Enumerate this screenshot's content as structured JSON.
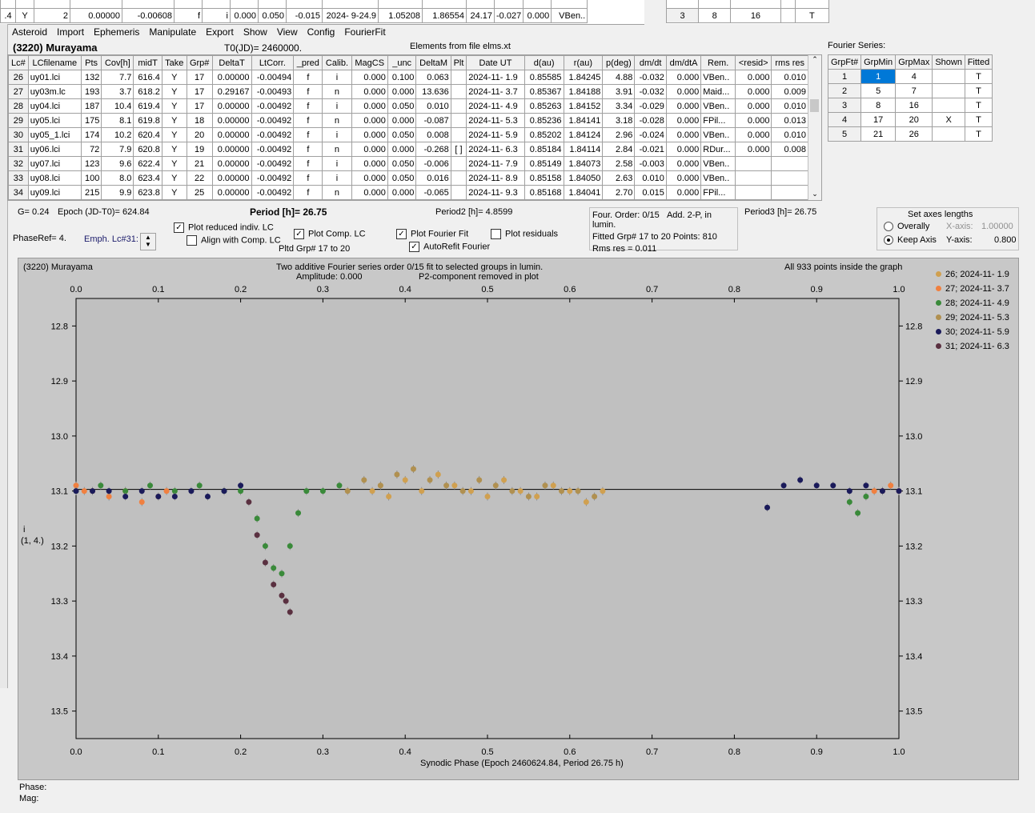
{
  "top_strip": {
    "rows": [
      {
        "a": ".4",
        "b": "Y",
        "c": "2",
        "d": "0.00000",
        "e": "-0.00608",
        "f": "f",
        "g": "i",
        "h": "0.000",
        "i": "0.050",
        "j": "-0.015",
        "k": "2024- 9-24.9",
        "l": "1.05208",
        "m": "1.86554",
        "n": "24.17",
        "o": "-0.027",
        "p": "0.000",
        "q": "VBen.."
      }
    ],
    "right_row": {
      "a": "3",
      "b": "8",
      "c": "16",
      "d": "",
      "e": "T"
    }
  },
  "menu": [
    "Asteroid",
    "Import",
    "Ephemeris",
    "Manipulate",
    "Export",
    "Show",
    "View",
    "Config",
    "FourierFit"
  ],
  "asteroid_title": "(3220) Murayama",
  "t0_label": "T0(JD)= 2460000.",
  "elements_label": "Elements from file elms.xt",
  "lc_table": {
    "headers": [
      "Lc#",
      "LCfilename",
      "Pts",
      "Cov[h]",
      "midT",
      "Take",
      "Grp#",
      "DeltaT",
      "LtCorr.",
      "_pred",
      "Calib.",
      "MagCS",
      "_unc",
      "DeltaM",
      "Plt",
      "Date UT",
      "d(au)",
      "r(au)",
      "p(deg)",
      "dm/dt",
      "dm/dtA",
      "Rem.",
      "<resid>",
      "rms res"
    ],
    "rows": [
      [
        "26",
        "uy01.lci",
        "132",
        "7.7",
        "616.4",
        "Y",
        "17",
        "0.00000",
        "-0.00494",
        "f",
        "i",
        "0.000",
        "0.100",
        "0.063",
        "",
        "2024-11- 1.9",
        "0.85585",
        "1.84245",
        "4.88",
        "-0.032",
        "0.000",
        "VBen..",
        "0.000",
        "0.010"
      ],
      [
        "27",
        "uy03m.lc",
        "193",
        "3.7",
        "618.2",
        "Y",
        "17",
        "0.29167",
        "-0.00493",
        "f",
        "n",
        "0.000",
        "0.000",
        "13.636",
        "",
        "2024-11- 3.7",
        "0.85367",
        "1.84188",
        "3.91",
        "-0.032",
        "0.000",
        "Maid...",
        "0.000",
        "0.009"
      ],
      [
        "28",
        "uy04.lci",
        "187",
        "10.4",
        "619.4",
        "Y",
        "17",
        "0.00000",
        "-0.00492",
        "f",
        "i",
        "0.000",
        "0.050",
        "0.010",
        "",
        "2024-11- 4.9",
        "0.85263",
        "1.84152",
        "3.34",
        "-0.029",
        "0.000",
        "VBen..",
        "0.000",
        "0.010"
      ],
      [
        "29",
        "uy05.lci",
        "175",
        "8.1",
        "619.8",
        "Y",
        "18",
        "0.00000",
        "-0.00492",
        "f",
        "n",
        "0.000",
        "0.000",
        "-0.087",
        "",
        "2024-11- 5.3",
        "0.85236",
        "1.84141",
        "3.18",
        "-0.028",
        "0.000",
        "FPil...",
        "0.000",
        "0.013"
      ],
      [
        "30",
        "uy05_1.lci",
        "174",
        "10.2",
        "620.4",
        "Y",
        "20",
        "0.00000",
        "-0.00492",
        "f",
        "i",
        "0.000",
        "0.050",
        "0.008",
        "",
        "2024-11- 5.9",
        "0.85202",
        "1.84124",
        "2.96",
        "-0.024",
        "0.000",
        "VBen..",
        "0.000",
        "0.010"
      ],
      [
        "31",
        "uy06.lci",
        "72",
        "7.9",
        "620.8",
        "Y",
        "19",
        "0.00000",
        "-0.00492",
        "f",
        "n",
        "0.000",
        "0.000",
        "-0.268",
        "[ ]",
        "2024-11- 6.3",
        "0.85184",
        "1.84114",
        "2.84",
        "-0.021",
        "0.000",
        "RDur...",
        "0.000",
        "0.008"
      ],
      [
        "32",
        "uy07.lci",
        "123",
        "9.6",
        "622.4",
        "Y",
        "21",
        "0.00000",
        "-0.00492",
        "f",
        "i",
        "0.000",
        "0.050",
        "-0.006",
        "",
        "2024-11- 7.9",
        "0.85149",
        "1.84073",
        "2.58",
        "-0.003",
        "0.000",
        "VBen..",
        "",
        ""
      ],
      [
        "33",
        "uy08.lci",
        "100",
        "8.0",
        "623.4",
        "Y",
        "22",
        "0.00000",
        "-0.00492",
        "f",
        "i",
        "0.000",
        "0.050",
        "0.016",
        "",
        "2024-11- 8.9",
        "0.85158",
        "1.84050",
        "2.63",
        "0.010",
        "0.000",
        "VBen..",
        "",
        ""
      ],
      [
        "34",
        "uy09.lci",
        "215",
        "9.9",
        "623.8",
        "Y",
        "25",
        "0.00000",
        "-0.00492",
        "f",
        "n",
        "0.000",
        "0.000",
        "-0.065",
        "",
        "2024-11- 9.3",
        "0.85168",
        "1.84041",
        "2.70",
        "0.015",
        "0.000",
        "FPil...",
        "",
        ""
      ]
    ]
  },
  "fourier": {
    "title": "Fourier Series:",
    "headers": [
      "GrpFt#",
      "GrpMin",
      "GrpMax",
      "Shown",
      "Fitted"
    ],
    "rows": [
      [
        "1",
        "1",
        "4",
        "",
        "T"
      ],
      [
        "2",
        "5",
        "7",
        "",
        "T"
      ],
      [
        "3",
        "8",
        "16",
        "",
        "T"
      ],
      [
        "4",
        "17",
        "20",
        "X",
        "T"
      ],
      [
        "5",
        "21",
        "26",
        "",
        "T"
      ]
    ]
  },
  "controls": {
    "g_label": "G= 0.24",
    "epoch_label": "Epoch (JD-T0)= 624.84",
    "period_label": "Period [h]= 26.75",
    "period2_label": "Period2 [h]= 4.8599",
    "period3_label": "Period3 [h]= 26.75",
    "phaseref_label": "PhaseRef= 4.",
    "emph_label": "Emph. Lc#31:",
    "plot_reduced": "Plot reduced indiv. LC",
    "align_comp": "Align with Comp. LC",
    "plot_comp": "Plot Comp. LC",
    "pltd_grp": "Pltd Grp#  17 to   20",
    "plot_fourier": "Plot Fourier Fit",
    "autorefit": "AutoRefit Fourier",
    "plot_residuals": "Plot residuals",
    "four_order": "Four. Order:  0/15",
    "add2p": "Add. 2-P,  in lumin.",
    "fitted_grp": "Fitted Grp# 17 to 20 Points: 810",
    "rms_res": "Rms res      = 0.011",
    "axes_title": "Set axes lengths",
    "overally": "Overally",
    "keep_axis": "Keep Axis",
    "xaxis_label": "X-axis:",
    "xaxis_val": "1.00000",
    "yaxis_label": "Y-axis:",
    "yaxis_val": "0.800"
  },
  "graph": {
    "title_left": "(3220) Murayama",
    "title_center1": "Two additive Fourier series order 0/15 fit to selected groups in lumin.",
    "title_center2": "Amplitude: 0.000",
    "title_center3": "P2-component removed in plot",
    "title_right": "All 933 points inside the graph",
    "ylabel1": "i",
    "ylabel2": "(1, 4.)",
    "xlabel": "Synodic Phase (Epoch 2460624.84, Period 26.75 h)",
    "phase_label": "Phase:",
    "mag_label": "Mag:"
  },
  "chart_data": {
    "type": "scatter",
    "title": "Two additive Fourier series order 0/15 fit to selected groups in lumin.",
    "xlabel": "Synodic Phase (Epoch 2460624.84, Period 26.75 h)",
    "ylabel": "i (1, 4.)",
    "xlim": [
      0.0,
      1.0
    ],
    "ylim": [
      12.75,
      13.55
    ],
    "y_inverted": true,
    "x_ticks": [
      "0.0",
      "0.1",
      "0.2",
      "0.3",
      "0.4",
      "0.5",
      "0.6",
      "0.7",
      "0.8",
      "0.9",
      "1.0"
    ],
    "y_ticks": [
      "12.8",
      "12.9",
      "13.0",
      "13.1",
      "13.2",
      "13.3",
      "13.4",
      "13.5"
    ],
    "fit_line": {
      "x": [
        0.0,
        1.0
      ],
      "y": [
        13.097,
        13.097
      ]
    },
    "legend_position": "right",
    "series": [
      {
        "name": "26; 2024-11- 1.9",
        "color": "#d0a050",
        "x": [
          0.36,
          0.37,
          0.38,
          0.4,
          0.42,
          0.44,
          0.46,
          0.48,
          0.5,
          0.52,
          0.54,
          0.56,
          0.58,
          0.6,
          0.62,
          0.64
        ],
        "y": [
          13.1,
          13.09,
          13.11,
          13.08,
          13.1,
          13.07,
          13.09,
          13.1,
          13.11,
          13.08,
          13.1,
          13.11,
          13.09,
          13.1,
          13.12,
          13.1
        ]
      },
      {
        "name": "27; 2024-11- 3.7",
        "color": "#f08040",
        "x": [
          0.0,
          0.01,
          0.02,
          0.04,
          0.06,
          0.08,
          0.1,
          0.11,
          0.97,
          0.98,
          0.99,
          1.0
        ],
        "y": [
          13.09,
          13.1,
          13.1,
          13.11,
          13.1,
          13.12,
          13.11,
          13.1,
          13.1,
          13.1,
          13.09,
          13.1
        ]
      },
      {
        "name": "28; 2024-11- 4.9",
        "color": "#3a8a3a",
        "x": [
          0.0,
          0.03,
          0.06,
          0.09,
          0.12,
          0.15,
          0.18,
          0.2,
          0.22,
          0.23,
          0.24,
          0.25,
          0.26,
          0.27,
          0.28,
          0.3,
          0.32,
          0.94,
          0.95,
          0.96
        ],
        "y": [
          13.1,
          13.09,
          13.1,
          13.09,
          13.1,
          13.09,
          13.1,
          13.1,
          13.15,
          13.2,
          13.24,
          13.25,
          13.2,
          13.14,
          13.1,
          13.1,
          13.09,
          13.12,
          13.14,
          13.11
        ]
      },
      {
        "name": "29; 2024-11- 5.3",
        "color": "#b09050",
        "x": [
          0.33,
          0.35,
          0.37,
          0.39,
          0.41,
          0.43,
          0.45,
          0.47,
          0.49,
          0.51,
          0.53,
          0.55,
          0.57,
          0.59,
          0.61,
          0.63
        ],
        "y": [
          13.1,
          13.08,
          13.09,
          13.07,
          13.06,
          13.08,
          13.09,
          13.1,
          13.08,
          13.09,
          13.1,
          13.11,
          13.09,
          13.1,
          13.1,
          13.11
        ]
      },
      {
        "name": "30; 2024-11- 5.9",
        "color": "#1a1a5a",
        "x": [
          0.0,
          0.02,
          0.04,
          0.06,
          0.08,
          0.1,
          0.12,
          0.14,
          0.16,
          0.18,
          0.2,
          0.84,
          0.86,
          0.88,
          0.9,
          0.92,
          0.94,
          0.96,
          0.98,
          1.0
        ],
        "y": [
          13.1,
          13.1,
          13.1,
          13.11,
          13.1,
          13.11,
          13.11,
          13.1,
          13.11,
          13.1,
          13.09,
          13.13,
          13.09,
          13.08,
          13.09,
          13.09,
          13.1,
          13.09,
          13.1,
          13.1
        ]
      },
      {
        "name": "31; 2024-11- 6.3",
        "color": "#5a3040",
        "x": [
          0.21,
          0.22,
          0.23,
          0.24,
          0.25,
          0.255,
          0.26
        ],
        "y": [
          13.12,
          13.18,
          13.23,
          13.27,
          13.29,
          13.3,
          13.32
        ]
      }
    ]
  }
}
